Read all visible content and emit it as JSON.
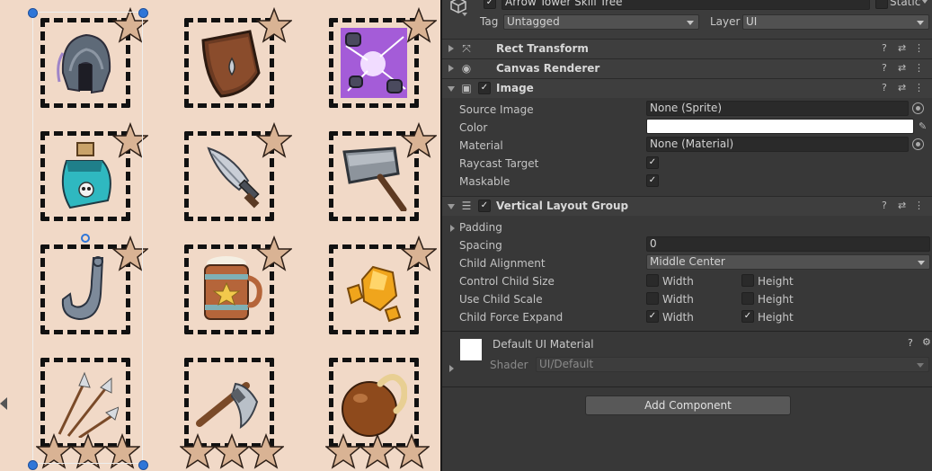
{
  "scene": {
    "background": "#f1d9c7",
    "items": [
      {
        "name": "helmet",
        "icon": "helmet-icon"
      },
      {
        "name": "shield",
        "icon": "shield-icon"
      },
      {
        "name": "magic-orb",
        "icon": "magic-orb-icon"
      },
      {
        "name": "poison-potion",
        "icon": "potion-icon"
      },
      {
        "name": "dagger",
        "icon": "dagger-icon"
      },
      {
        "name": "hammer",
        "icon": "hammer-icon"
      },
      {
        "name": "hook",
        "icon": "hook-icon"
      },
      {
        "name": "mug",
        "icon": "mug-icon"
      },
      {
        "name": "gold-nuggets",
        "icon": "gold-icon"
      },
      {
        "name": "arrows",
        "icon": "arrows-icon"
      },
      {
        "name": "axe",
        "icon": "axe-icon"
      },
      {
        "name": "bomb",
        "icon": "bomb-icon"
      }
    ],
    "star_color": "#d9b394"
  },
  "inspector": {
    "object_name": "Arrow Tower Skill Tree",
    "static_label": "Static",
    "tag_label": "Tag",
    "tag_value": "Untagged",
    "layer_label": "Layer",
    "layer_value": "UI",
    "components": {
      "rect_transform": "Rect Transform",
      "canvas_renderer": "Canvas Renderer",
      "image": "Image",
      "vertical_layout_group": "Vertical Layout Group"
    },
    "image_props": {
      "source_image_label": "Source Image",
      "source_image_value": "None (Sprite)",
      "color_label": "Color",
      "color_value": "#ffffff",
      "material_label": "Material",
      "material_value": "None (Material)",
      "raycast_label": "Raycast Target",
      "maskable_label": "Maskable"
    },
    "layout_props": {
      "padding_label": "Padding",
      "spacing_label": "Spacing",
      "spacing_value": "0",
      "child_alignment_label": "Child Alignment",
      "child_alignment_value": "Middle Center",
      "control_child_size_label": "Control Child Size",
      "use_child_scale_label": "Use Child Scale",
      "child_force_expand_label": "Child Force Expand",
      "width_label": "Width",
      "height_label": "Height"
    },
    "material_block": {
      "name": "Default UI Material",
      "shader_label": "Shader",
      "shader_value": "UI/Default"
    },
    "add_component_label": "Add Component"
  }
}
